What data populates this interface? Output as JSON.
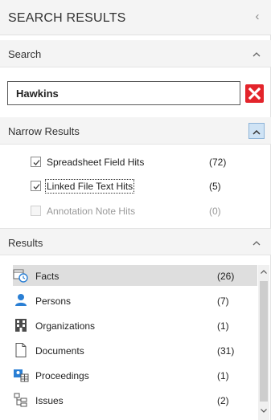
{
  "header": {
    "title": "SEARCH RESULTS",
    "collapse_glyph": "‹"
  },
  "search_section": {
    "label": "Search",
    "chevron": "^"
  },
  "search": {
    "value": "Hawkins",
    "clear_icon": "close-icon",
    "clear_color": "#e3242b"
  },
  "narrow_section": {
    "label": "Narrow Results",
    "chevron": "^"
  },
  "narrow_items": [
    {
      "label": "Spreadsheet Field Hits",
      "count": "(72)",
      "checked": true,
      "enabled": true
    },
    {
      "label": "Linked File Text Hits",
      "count": "(5)",
      "checked": true,
      "enabled": true
    },
    {
      "label": "Annotation Note Hits",
      "count": "(0)",
      "checked": false,
      "enabled": false
    }
  ],
  "results_section": {
    "label": "Results",
    "chevron": "^"
  },
  "results": [
    {
      "label": "Facts",
      "count": "(26)",
      "icon": "facts-calendar-icon",
      "selected": true
    },
    {
      "label": "Persons",
      "count": "(7)",
      "icon": "person-icon",
      "selected": false
    },
    {
      "label": "Organizations",
      "count": "(1)",
      "icon": "building-icon",
      "selected": false
    },
    {
      "label": "Documents",
      "count": "(31)",
      "icon": "document-icon",
      "selected": false
    },
    {
      "label": "Proceedings",
      "count": "(1)",
      "icon": "proceedings-icon",
      "selected": false
    },
    {
      "label": "Issues",
      "count": "(2)",
      "icon": "issues-tree-icon",
      "selected": false
    }
  ],
  "colors": {
    "accent": "#2a7fd4",
    "selected_row": "#dedede",
    "section_bg": "#f4f4f4"
  }
}
